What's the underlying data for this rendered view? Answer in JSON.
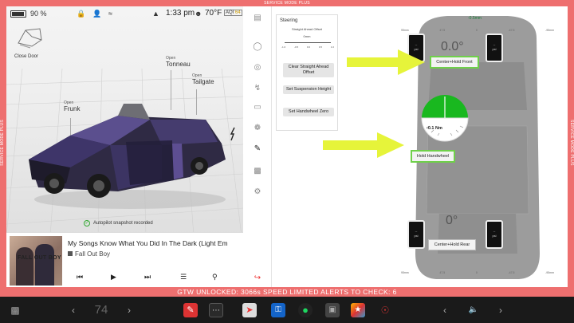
{
  "service_mode": {
    "top": "SERVICE MODE PLUS",
    "left": "SERVICE MODE PLUS",
    "right": "SERVICE MODE PLUS"
  },
  "status": {
    "battery_pct": "90 %",
    "time": "1:33 pm",
    "temp": "70°F",
    "aqi_label": "AQI",
    "aqi_value": "64"
  },
  "vehicle": {
    "close_door": "Close Door",
    "frunk": {
      "state": "Open",
      "name": "Frunk"
    },
    "tonneau": {
      "state": "Open",
      "name": "Tonneau"
    },
    "tailgate": {
      "state": "Open",
      "name": "Tailgate"
    },
    "autopilot_msg": "Autopilot snapshot recorded"
  },
  "media": {
    "title": "My Songs Know What You Did In The Dark (Light Em",
    "artist": "Fall Out Boy",
    "album_text": "FALL OUT BOY"
  },
  "steering": {
    "title": "Steering",
    "offset_label": "Straight Ahead Offset",
    "offset_value": "0mm",
    "scale": [
      "-1.0",
      "-0.5",
      "0.0",
      "0.5",
      "1.0"
    ],
    "buttons": [
      "Clear Straight Ahead Offset",
      "Set Suspension Height",
      "Set Handwheel Zero"
    ]
  },
  "alignment": {
    "front_angle": "0.0°",
    "rear_angle": "0°",
    "front_button": "Center+Hold Front",
    "rear_button": "Center+Hold Rear",
    "handwheel_button": "Hold Handwheel",
    "handwheel_torque": "-0.1 Nm",
    "top_offset": "-0.5mm",
    "front_ticks": [
      "95mm",
      "47.5",
      "0",
      "-47.5",
      "-95mm"
    ],
    "rear_ticks": [
      "95mm",
      "47.5",
      "0",
      "-47.5",
      "-95mm"
    ],
    "tire_value": "--",
    "tire_unit": "psi"
  },
  "alerts": {
    "text": "GTW UNLOCKED: 3066s    SPEED LIMITED    ALERTS TO CHECK: 6"
  },
  "taskbar": {
    "temp_value": "74",
    "left_chevron": "‹",
    "right_chevron": "›"
  },
  "colors": {
    "service_red": "#ee6f6f",
    "accent_green": "#1fbf2a",
    "arrow_yellow": "#e8f53a"
  }
}
